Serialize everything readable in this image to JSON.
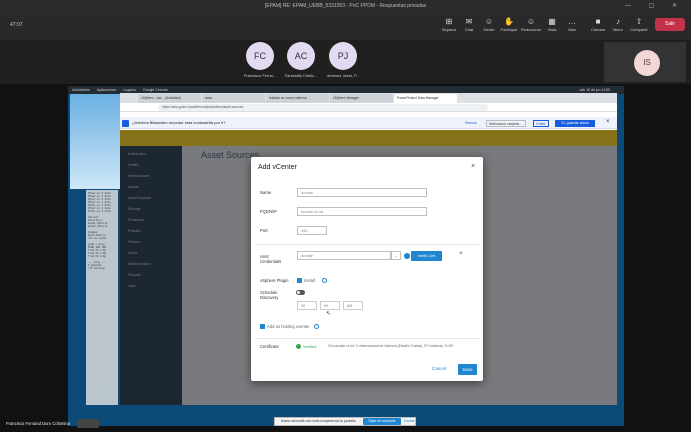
{
  "window": {
    "title": "[EPAM] RE: EPAM_UEBB_5331053 - PoC PPDM - Respuestas privadas",
    "timer": "47:07",
    "controls": "— ▢ ✕"
  },
  "toolbar": {
    "buttons": [
      {
        "label": "Separar",
        "icon": "⊞"
      },
      {
        "label": "Chat",
        "icon": "✉"
      },
      {
        "label": "Gente",
        "icon": "☺"
      },
      {
        "label": "Participar",
        "icon": "✋"
      },
      {
        "label": "Reaccionar",
        "icon": "☺"
      },
      {
        "label": "Vista",
        "icon": "▦"
      },
      {
        "label": "Más",
        "icon": "…"
      },
      {
        "label": "Cámara",
        "icon": "■"
      },
      {
        "label": "Micro",
        "icon": "♪"
      },
      {
        "label": "Compartir",
        "icon": "⇧"
      }
    ],
    "leave_label": "Salir"
  },
  "participants": [
    {
      "initials": "FC",
      "name": "Francisco Ferna..."
    },
    {
      "initials": "AC",
      "name": "Fantasilla Chelic..."
    },
    {
      "initials": "PJ",
      "name": "Jimenez Jesst, P..."
    }
  ],
  "self_tile": {
    "initials": "IS"
  },
  "os_bar": {
    "items": [
      "Actividades",
      "Aplicaciones",
      "Lugares",
      "Google Chrome"
    ],
    "clock": "sáb 15 de jun 11:55"
  },
  "browser": {
    "tabs": [
      "vSphere - vce... (Actividad)",
      "www",
      "Instalar un nuevo sistema",
      "vSphere Manager",
      "PowerProtect Data Manager"
    ],
    "active_tab": 4,
    "address": "https://cdsi.ppdm.local/#/home/protection/asset-sources"
  },
  "password_bar": {
    "text": "¿Debería Bitwarden recordar esta contraseña por ti?",
    "never": "Nunca",
    "select": "Seleccione carpeta...",
    "edit": "Editar",
    "save": "Sí, guardar ahora"
  },
  "app": {
    "banner": "",
    "page_title": "Asset Sources",
    "sidebar": [
      "Dashboard",
      "Health",
      "Infrastructure",
      "Assets",
      "Asset Sources",
      "Storage",
      "Protection",
      "Policies",
      "Restore",
      "Alerts",
      "Administration",
      "Reports",
      "Jobs"
    ]
  },
  "modal": {
    "title": "Add vCenter",
    "close": "×",
    "fields": {
      "name": {
        "label": "Name",
        "value": "dcvsde"
      },
      "fqdn": {
        "label": "FQDN/IP",
        "value": "dcvsde.cx.int"
      },
      "port": {
        "label": "Port",
        "value": "443"
      }
    },
    "host_credentials": {
      "label": "Host Credentials",
      "value": "dcvsde",
      "verify": "Verify Cert",
      "close": "×"
    },
    "vsphere_plugin": {
      "label": "vSphere Plugin",
      "option": "Install"
    },
    "schedule_discovery": {
      "label": "Schedule Discovery",
      "values": [
        "00",
        "00",
        "AM"
      ]
    },
    "add_hosting": {
      "label": "Add as hosting vcenter"
    },
    "certificate": {
      "label": "Certificate",
      "status": "Verified",
      "detail": "CN=dcvsde.cx.int, C=Internacional de Valencia (Estadio Ciudad), ST=Valencia, O=EH"
    },
    "cancel": "Cancel",
    "save": "Save"
  },
  "notification": {
    "text": "teams.microsoft.com está compartiendo tu pantalla",
    "button": "Dejar de compartir",
    "link": "Ocultar"
  },
  "presenter": {
    "name": "Francisco Fernand Duro Colomina"
  },
  "terminal_lines": [
    "Dfusr-in 2 data",
    "Dfusr-in 3 data",
    "Dfusr-in 2 data",
    "Dfusr-in 1 data",
    "Dfusr-in 2 data",
    "Dfusr-in 2 data",
    "Dfusr-in 3 data",
    "",
    "hello=1",
    "Selection:",
    "Zona1 Ufacile",
    "Zona3 Ufacile",
    "",
    "Images:",
    "Done destroy",
    "foo ns cache",
    "",
    "ppdm > ping",
    "PING 192 168",
    "from 64 icmp",
    "from 64 icmp",
    "from 64 icmp",
    "",
    "--- ping ---",
    "5 packets",
    "rtt min/avg"
  ]
}
